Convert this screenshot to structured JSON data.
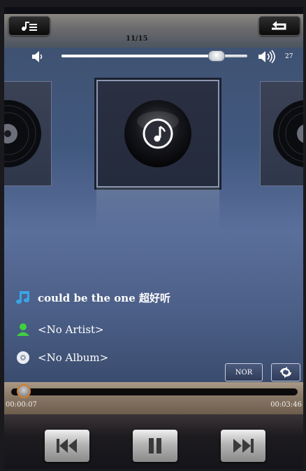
{
  "header": {
    "track_counter": "11/15",
    "playlist_icon": "playlist-icon",
    "repeat_icon": "repeat-icon"
  },
  "volume": {
    "value": "27",
    "level_fraction": 0.83,
    "icon_low": "volume-low-icon",
    "icon_high": "volume-high-icon"
  },
  "album": {
    "cover_icon": "music-note-disc-icon"
  },
  "song": {
    "title": "could be the one 超好听",
    "artist": "<No Artist>",
    "album": "<No Album>"
  },
  "mode": {
    "play_mode_label": "NOR",
    "shuffle_icon": "shuffle-icon"
  },
  "playback": {
    "elapsed": "00:00:07",
    "total": "00:03:46",
    "progress_fraction": 0.03
  },
  "controls": {
    "prev_icon": "previous-icon",
    "pause_icon": "pause-icon",
    "next_icon": "next-icon"
  },
  "colors": {
    "accent_orange": "#d37d2e",
    "main_bg": "#4b5e86"
  }
}
